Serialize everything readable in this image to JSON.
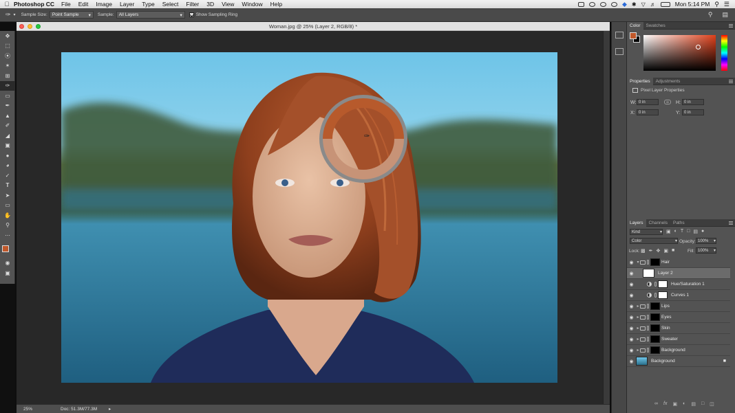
{
  "menubar": {
    "app_name": "Photoshop CC",
    "items": [
      "File",
      "Edit",
      "Image",
      "Layer",
      "Type",
      "Select",
      "Filter",
      "3D",
      "View",
      "Window",
      "Help"
    ],
    "clock": "Mon 5:14 PM"
  },
  "options_bar": {
    "sample_size_label": "Sample Size:",
    "sample_size_value": "Point Sample",
    "sample_label": "Sample:",
    "sample_value": "All Layers",
    "sampling_ring_label": "Show Sampling Ring",
    "sampling_ring_checked": true
  },
  "document": {
    "title": "Woman.jpg @ 25% (Layer 2, RGB/8) *",
    "zoom": "25%",
    "doc_size": "Doc: 51.3M/77.3M"
  },
  "color_panel": {
    "tabs": [
      "Color",
      "Swatches"
    ],
    "foreground": "#c0582a",
    "background": "#000000",
    "sampled_top": "#b75a2c",
    "sampled_bottom": "#c79377"
  },
  "properties_panel": {
    "tabs": [
      "Properties",
      "Adjustments"
    ],
    "heading": "Pixel Layer Properties",
    "w_label": "W:",
    "w_value": "0 in",
    "h_label": "H:",
    "h_value": "0 in",
    "x_label": "X:",
    "x_value": "0 in",
    "y_label": "Y:",
    "y_value": "0 in"
  },
  "layers_panel": {
    "tabs": [
      "Layers",
      "Channels",
      "Paths"
    ],
    "filter_kind": "Kind",
    "blend_mode": "Color",
    "opacity_label": "Opacity:",
    "opacity_value": "100%",
    "lock_label": "Lock:",
    "fill_label": "Fill:",
    "fill_value": "100%",
    "layers": [
      {
        "name": "Hair",
        "type": "group",
        "expanded": true
      },
      {
        "name": "Layer 2",
        "type": "pixel",
        "selected": true
      },
      {
        "name": "Hue/Saturation 1",
        "type": "adjustment"
      },
      {
        "name": "Curves 1",
        "type": "adjustment"
      },
      {
        "name": "Lips",
        "type": "group"
      },
      {
        "name": "Eyes",
        "type": "group"
      },
      {
        "name": "Skin",
        "type": "group"
      },
      {
        "name": "Sweater",
        "type": "group"
      },
      {
        "name": "Background",
        "type": "group"
      },
      {
        "name": "Background",
        "type": "background",
        "locked": true
      }
    ]
  },
  "tools": [
    "move-tool",
    "marquee-tool",
    "lasso-tool",
    "quick-select-tool",
    "crop-tool",
    "eyedropper-tool",
    "healing-tool",
    "brush-tool",
    "stamp-tool",
    "history-brush-tool",
    "eraser-tool",
    "gradient-tool",
    "blur-tool",
    "dodge-tool",
    "pen-tool",
    "type-tool",
    "path-select-tool",
    "shape-tool",
    "hand-tool",
    "zoom-tool",
    "more-tools"
  ]
}
